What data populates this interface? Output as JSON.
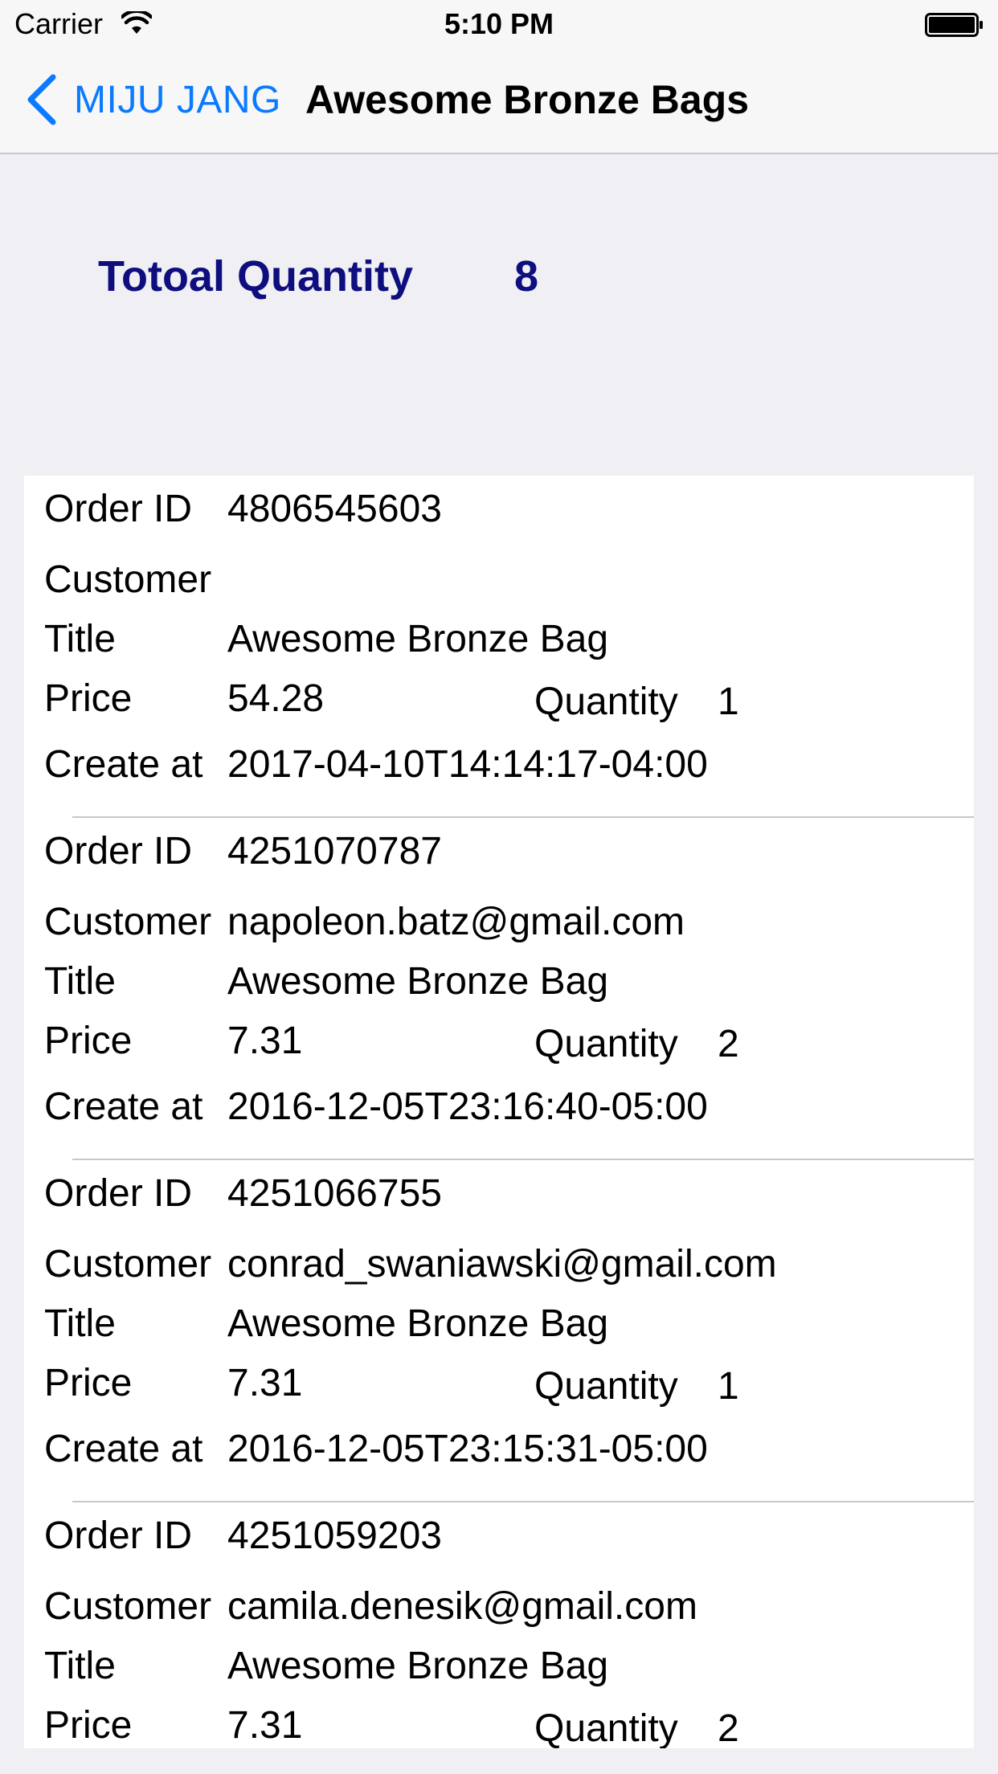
{
  "status_bar": {
    "carrier": "Carrier",
    "time": "5:10 PM",
    "icons": [
      "wifi-icon",
      "battery-icon"
    ]
  },
  "nav": {
    "back_label": "MIJU JANG",
    "title": "Awesome Bronze Bags",
    "accent_color": "#0a7aff"
  },
  "summary": {
    "label": "Totoal Quantity",
    "value": "8",
    "color": "#0e0e7e"
  },
  "labels": {
    "order_id": "Order ID",
    "customer": "Customer",
    "title": "Title",
    "price": "Price",
    "quantity": "Quantity",
    "created": "Create at"
  },
  "orders": [
    {
      "order_id": "4806545603",
      "customer": "",
      "title": "Awesome Bronze Bag",
      "price": "54.28",
      "quantity": "1",
      "created_at": "2017-04-10T14:14:17-04:00"
    },
    {
      "order_id": "4251070787",
      "customer": "napoleon.batz@gmail.com",
      "title": "Awesome Bronze Bag",
      "price": "7.31",
      "quantity": "2",
      "created_at": "2016-12-05T23:16:40-05:00"
    },
    {
      "order_id": "4251066755",
      "customer": "conrad_swaniawski@gmail.com",
      "title": "Awesome Bronze Bag",
      "price": "7.31",
      "quantity": "1",
      "created_at": "2016-12-05T23:15:31-05:00"
    },
    {
      "order_id": "4251059203",
      "customer": "camila.denesik@gmail.com",
      "title": "Awesome Bronze Bag",
      "price": "7.31",
      "quantity": "2",
      "created_at": ""
    }
  ]
}
